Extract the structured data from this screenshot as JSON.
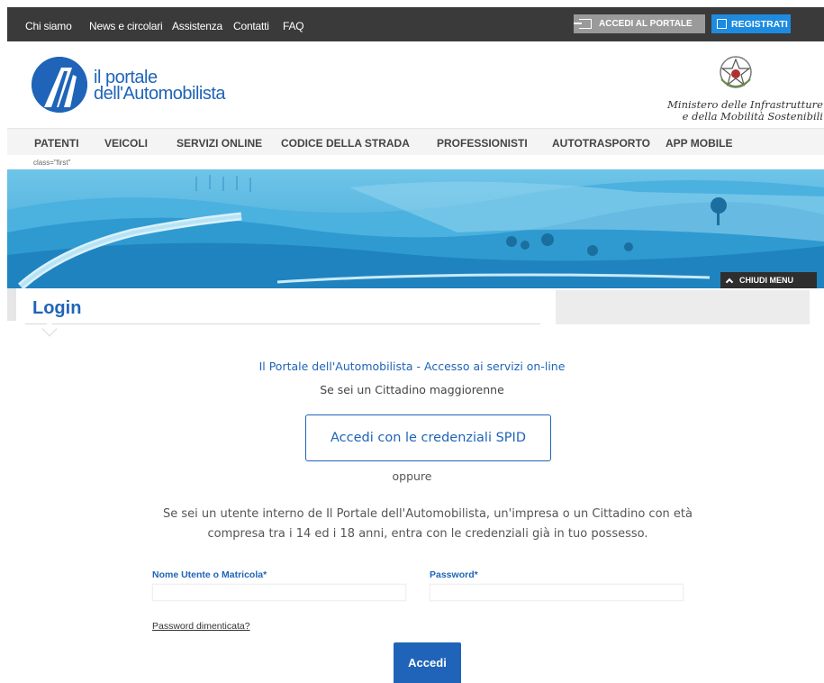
{
  "topbar": {
    "links": [
      "Chi siamo",
      "News e circolari",
      "Assistenza",
      "Contatti",
      "FAQ"
    ],
    "accedi_portale": "ACCEDI AL PORTALE",
    "registrati": "REGISTRATI"
  },
  "header": {
    "logo_line1": "il portale",
    "logo_line2": "dell'Automobilista",
    "ministero_line1": "Ministero delle Infrastrutture",
    "ministero_line2": "e della Mobilità Sostenibili"
  },
  "nav": {
    "items": [
      "PATENTI",
      "VEICOLI",
      "SERVIZI ONLINE",
      "CODICE DELLA STRADA",
      "PROFESSIONISTI",
      "AUTOTRASPORTO",
      "APP MOBILE"
    ]
  },
  "stray_text": "class=\"first\"",
  "hero": {
    "chiudi_menu": "CHIUDI MENU"
  },
  "login": {
    "title": "Login",
    "heading": "Il Portale dell'Automobilista - Accesso ai servizi on-line",
    "cittadino": "Se sei un Cittadino maggiorenne",
    "spid_button": "Accedi con le credenziali SPID",
    "oppure": "oppure",
    "interni": "Se sei un utente interno de Il Portale dell'Automobilista, un'impresa o un Cittadino con età compresa tra i 14 ed i 18 anni, entra con le credenziali già in tuo possesso.",
    "username_label": "Nome Utente o Matricola*",
    "username_value": "",
    "password_label": "Password*",
    "password_value": "",
    "forgot": "Password dimenticata?",
    "accedi": "Accedi"
  },
  "colors": {
    "brand_blue": "#1f64b8",
    "topbar": "#3a3a3a",
    "registrati": "#1d8be0"
  },
  "icons": [
    "login-arrow-icon",
    "edit-icon",
    "chevron-up-icon"
  ]
}
